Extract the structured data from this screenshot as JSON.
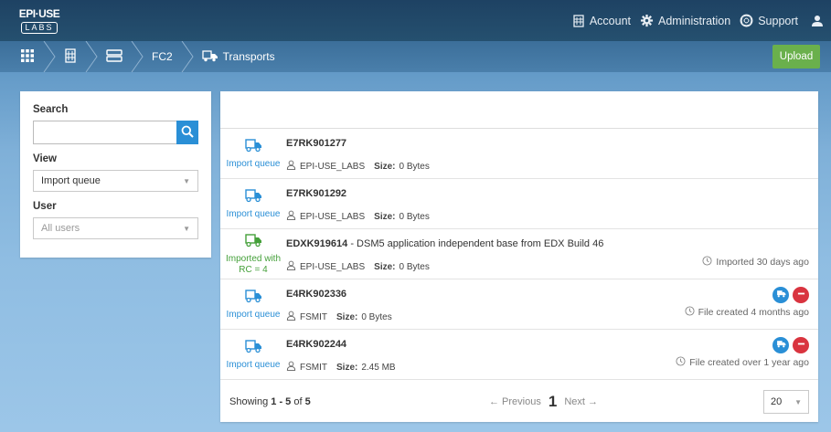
{
  "brand": {
    "line1": "EPI·USE",
    "line2": "LABS"
  },
  "topnav": {
    "account": "Account",
    "administration": "Administration",
    "support": "Support"
  },
  "breadcrumb": {
    "system": "FC2",
    "current": "Transports"
  },
  "upload_label": "Upload",
  "sidebar": {
    "search_label": "Search",
    "search_value": "",
    "view_label": "View",
    "view_value": "Import queue",
    "user_label": "User",
    "user_placeholder": "All users"
  },
  "transports": [
    {
      "id": "E7RK901277",
      "description": "",
      "status": "Import queue",
      "status_color": "#2a8fd6",
      "owner": "EPI-USE_LABS",
      "size_label": "Size:",
      "size": "0 Bytes",
      "note": "",
      "actions": false
    },
    {
      "id": "E7RK901292",
      "description": "",
      "status": "Import queue",
      "status_color": "#2a8fd6",
      "owner": "EPI-USE_LABS",
      "size_label": "Size:",
      "size": "0 Bytes",
      "note": "",
      "actions": false
    },
    {
      "id": "EDXK919614",
      "description": " - DSM5 application independent base from EDX Build 46",
      "status": "Imported with RC = 4",
      "status_color": "#45a03a",
      "owner": "EPI-USE_LABS",
      "size_label": "Size:",
      "size": "0 Bytes",
      "note": "Imported 30 days ago",
      "actions": false
    },
    {
      "id": "E4RK902336",
      "description": "",
      "status": "Import queue",
      "status_color": "#2a8fd6",
      "owner": "FSMIT",
      "size_label": "Size:",
      "size": "0 Bytes",
      "note": "File created 4 months ago",
      "actions": true
    },
    {
      "id": "E4RK902244",
      "description": "",
      "status": "Import queue",
      "status_color": "#2a8fd6",
      "owner": "FSMIT",
      "size_label": "Size:",
      "size": "2.45 MB",
      "note": "File created over 1 year ago",
      "actions": true
    }
  ],
  "footer": {
    "showing_prefix": "Showing ",
    "range": "1 - 5",
    "of_text": " of ",
    "total": "5",
    "previous": "← Previous",
    "current_page": "1",
    "next": "Next →",
    "per_page": "20"
  }
}
